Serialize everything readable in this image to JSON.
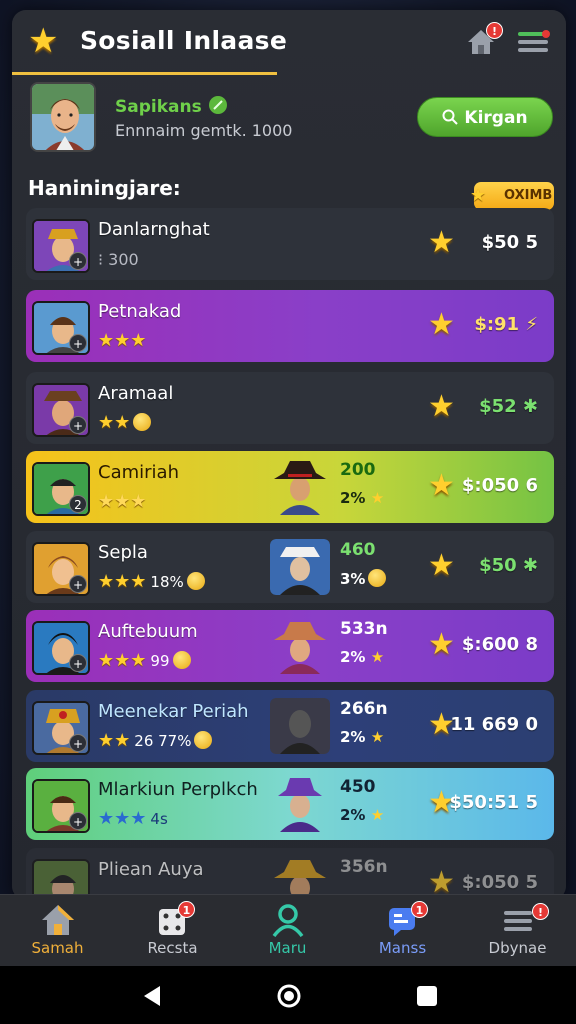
{
  "header": {
    "title": "Sosiall Inlaase",
    "menu_badge": "",
    "home_badge": "!"
  },
  "profile": {
    "name": "Sapikans",
    "subtitle": "Ennnaim gemtk. 1000",
    "button_label": "Kirgan"
  },
  "section": {
    "title": "Haniningjare:",
    "chip_label": "OXIMB"
  },
  "rows": [
    {
      "name": "Danlarnghat",
      "meta": "300",
      "amount": "$50 5",
      "style": "plain"
    },
    {
      "name": "Petnakad",
      "stars": "★★★",
      "amount": "$:91 ⚡",
      "style": "purple"
    },
    {
      "name": "Aramaal",
      "stars": "★★",
      "amount": "$52 ✱",
      "style": "plain"
    },
    {
      "name": "Camiriah",
      "stars": "★★★",
      "v1": "200",
      "v2": "2%",
      "amount": "$:050 6",
      "style": "yellow"
    },
    {
      "name": "Sepla",
      "stars": "★★★",
      "extra": "18%",
      "v1": "460",
      "v2": "3%",
      "amount": "$50 ✱",
      "style": "plain"
    },
    {
      "name": "Auftebuum",
      "stars": "★★★",
      "extra": "99",
      "v1": "533n",
      "v2": "2%",
      "amount": "$:600 8",
      "style": "purple"
    },
    {
      "name": "Meenekar Periah",
      "stars": "★★",
      "extra": "26 77%",
      "v1": "266n",
      "v2": "2%",
      "amount": "11 669 0",
      "style": "blue"
    },
    {
      "name": "Mlarkiun Perplkch",
      "stars": "★★★",
      "extra": "4s",
      "v1": "450",
      "v2": "2%",
      "amount": "$50:51 5",
      "style": "cyan"
    },
    {
      "name": "Pliean Auya",
      "v1": "356n",
      "v2": "",
      "amount": "$:050 5",
      "style": "faded"
    }
  ],
  "nav": [
    {
      "label": "Samah",
      "icon": "home-icon",
      "badge": ""
    },
    {
      "label": "Recsta",
      "icon": "dice-icon",
      "badge": "1"
    },
    {
      "label": "Maru",
      "icon": "user-icon",
      "badge": ""
    },
    {
      "label": "Manss",
      "icon": "chat-icon",
      "badge": "1"
    },
    {
      "label": "Dbynae",
      "icon": "menu-icon",
      "badge": "!"
    }
  ],
  "colors": {
    "accent_green": "#4fa52c",
    "gold": "#ffcf2e",
    "active_nav": "#f0b03a",
    "teal": "#35c8a8",
    "blue_nav": "#4a7cf0"
  }
}
